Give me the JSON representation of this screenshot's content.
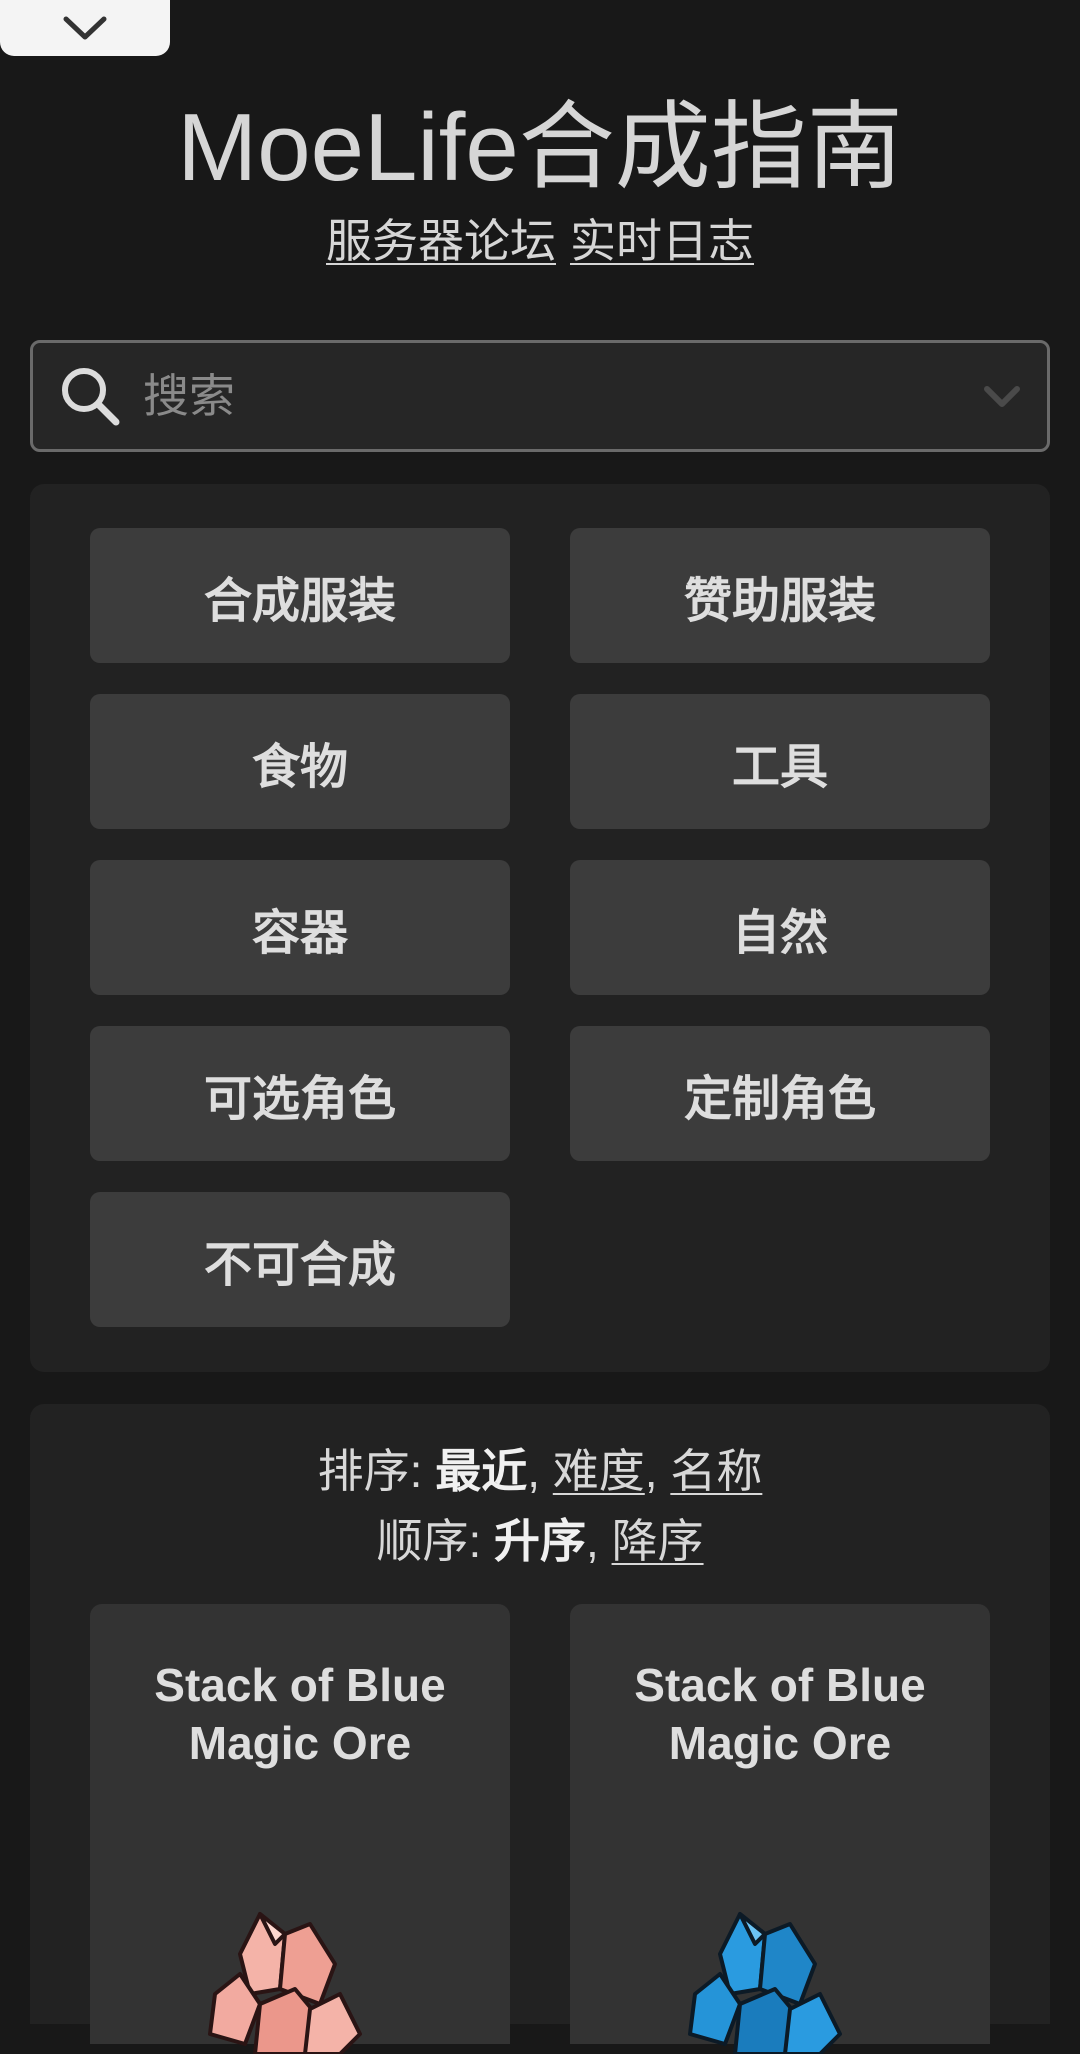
{
  "header": {
    "title": "MoeLife合成指南",
    "links": [
      "服务器论坛",
      "实时日志"
    ]
  },
  "search": {
    "placeholder": "搜索",
    "value": ""
  },
  "categories": [
    "合成服装",
    "赞助服装",
    "食物",
    "工具",
    "容器",
    "自然",
    "可选角色",
    "定制角色",
    "不可合成"
  ],
  "sort": {
    "label": "排序:",
    "options": [
      "最近",
      "难度",
      "名称"
    ],
    "active": "最近",
    "order_label": "顺序:",
    "order_options": [
      "升序",
      "降序"
    ],
    "order_active": "升序"
  },
  "items": [
    {
      "name": "Stack of Blue Magic Ore",
      "icon": "pink-crystal-ore-icon",
      "color": "#f0a39a"
    },
    {
      "name": "Stack of Blue Magic Ore",
      "icon": "blue-crystal-ore-icon",
      "color": "#1d8fd6"
    }
  ],
  "colors": {
    "background": "#181818",
    "panel": "#222222",
    "button": "#3c3c3c"
  }
}
